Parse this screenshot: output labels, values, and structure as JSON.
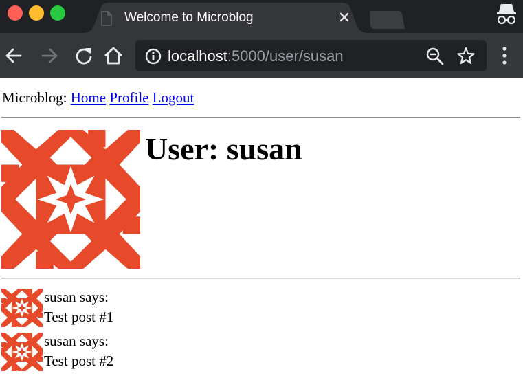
{
  "browser": {
    "tab_title": "Welcome to Microblog",
    "url_host": "localhost",
    "url_rest": ":5000/user/susan"
  },
  "nav": {
    "site_label": "Microblog:",
    "links": [
      "Home",
      "Profile",
      "Logout"
    ]
  },
  "profile": {
    "heading": "User: susan"
  },
  "posts": [
    {
      "author_line": "susan says:",
      "body": "Test post #1"
    },
    {
      "author_line": "susan says:",
      "body": "Test post #2"
    }
  ],
  "colors": {
    "avatar": "#e64a2a",
    "link": "#0000ee",
    "chrome_dark": "#202124",
    "chrome_toolbar": "#35363a"
  }
}
